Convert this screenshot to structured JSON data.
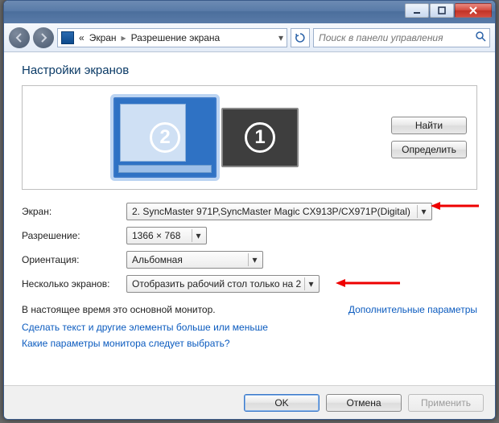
{
  "breadcrumb": {
    "level1": "Экран",
    "level2": "Разрешение экрана",
    "prefix": "«"
  },
  "search": {
    "placeholder": "Поиск в панели управления"
  },
  "page": {
    "title": "Настройки экранов"
  },
  "preview": {
    "identify_label": "Найти",
    "detect_label": "Определить",
    "monitors": [
      {
        "num": "2",
        "selected": true
      },
      {
        "num": "1",
        "selected": false
      }
    ]
  },
  "fields": {
    "display": {
      "label": "Экран:",
      "value": "2. SyncMaster 971P,SyncMaster Magic CX913P/CX971P(Digital)"
    },
    "resolution": {
      "label": "Разрешение:",
      "value": "1366 × 768"
    },
    "orientation": {
      "label": "Ориентация:",
      "value": "Альбомная"
    },
    "multi": {
      "label": "Несколько экранов:",
      "value": "Отобразить рабочий стол только на 2"
    }
  },
  "note": "В настоящее время это основной монитор.",
  "links": {
    "advanced": "Дополнительные параметры",
    "text_size": "Сделать текст и другие элементы больше или меньше",
    "which_settings": "Какие параметры монитора следует выбрать?"
  },
  "footer": {
    "ok": "OK",
    "cancel": "Отмена",
    "apply": "Применить"
  }
}
